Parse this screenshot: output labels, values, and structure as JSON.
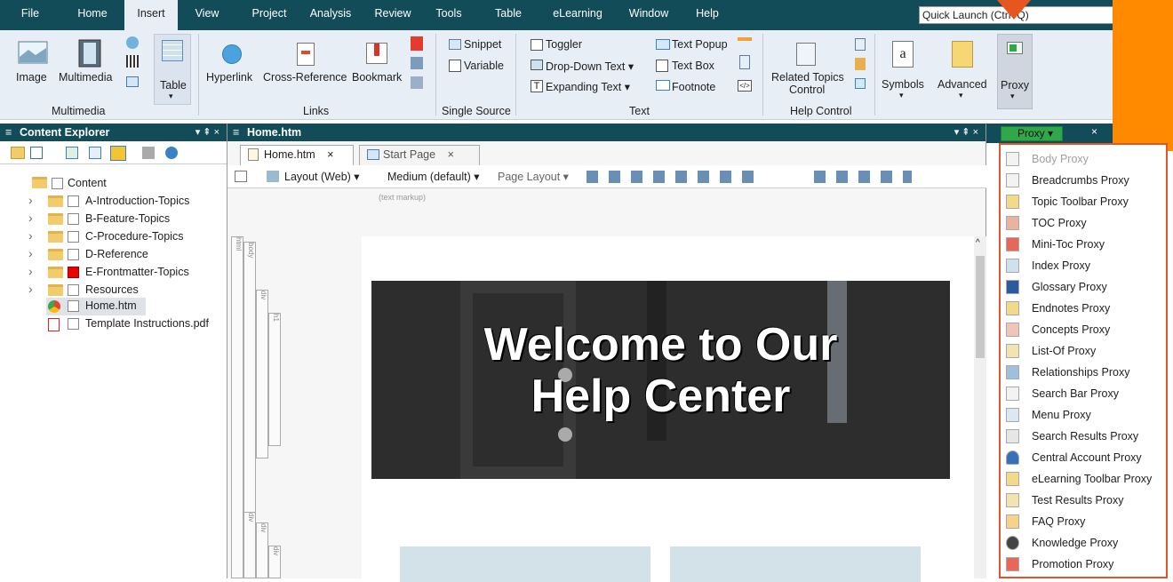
{
  "menubar": {
    "tabs": [
      "File",
      "Home",
      "Insert",
      "View",
      "Project",
      "Analysis",
      "Review",
      "Tools",
      "Table",
      "eLearning",
      "Window",
      "Help"
    ],
    "active": "Insert",
    "quick_launch": "Quick Launch (Ctrl+Q)"
  },
  "ribbon": {
    "image": "Image",
    "multimedia": "Multimedia",
    "table": "Table",
    "hyperlink": "Hyperlink",
    "crossref": "Cross-Reference",
    "bookmark": "Bookmark",
    "snippet": "Snippet",
    "variable": "Variable",
    "toggler": "Toggler",
    "dropdown_text": "Drop-Down Text",
    "expanding_text": "Expanding Text",
    "text_popup": "Text Popup",
    "text_box": "Text Box",
    "footnote": "Footnote",
    "related_topics": "Related Topics",
    "control": "Control",
    "symbols": "Symbols",
    "advanced": "Advanced",
    "proxy": "Proxy",
    "groups": {
      "multimedia": "Multimedia",
      "links": "Links",
      "single_source": "Single Source",
      "text": "Text",
      "help_control": "Help Control"
    }
  },
  "explorer": {
    "title": "Content Explorer",
    "root": "Content",
    "items": [
      {
        "label": "A-Introduction-Topics",
        "type": "folder"
      },
      {
        "label": "B-Feature-Topics",
        "type": "folder"
      },
      {
        "label": "C-Procedure-Topics",
        "type": "folder"
      },
      {
        "label": "D-Reference",
        "type": "folder"
      },
      {
        "label": "E-Frontmatter-Topics",
        "type": "folder"
      },
      {
        "label": "Resources",
        "type": "folder"
      },
      {
        "label": "Home.htm",
        "type": "file"
      },
      {
        "label": "Template Instructions.pdf",
        "type": "pdf"
      }
    ]
  },
  "editor": {
    "title": "Home.htm",
    "tabs": [
      "Home.htm",
      "Start Page"
    ],
    "toolbar": {
      "layout": "Layout (Web)",
      "medium": "Medium (default)",
      "page_layout": "Page Layout"
    },
    "text_markup": "(text markup)",
    "structure_tags": [
      "html",
      "body",
      "div",
      "h1",
      "div",
      "div",
      "div"
    ],
    "hero_line1": "Welcome to Our",
    "hero_line2": "Help Center"
  },
  "proxy": {
    "header_button": "Proxy",
    "items": [
      {
        "label": "Body Proxy",
        "disabled": true
      },
      {
        "label": "Breadcrumbs Proxy"
      },
      {
        "label": "Topic Toolbar Proxy"
      },
      {
        "label": "TOC Proxy"
      },
      {
        "label": "Mini-Toc Proxy"
      },
      {
        "label": "Index Proxy"
      },
      {
        "label": "Glossary Proxy"
      },
      {
        "label": "Endnotes Proxy"
      },
      {
        "label": "Concepts Proxy"
      },
      {
        "label": "List-Of Proxy"
      },
      {
        "label": "Relationships Proxy"
      },
      {
        "label": "Search Bar Proxy"
      },
      {
        "label": "Menu Proxy"
      },
      {
        "label": "Search Results Proxy"
      },
      {
        "label": "Central Account Proxy"
      },
      {
        "label": "eLearning Toolbar Proxy"
      },
      {
        "label": "Test Results Proxy"
      },
      {
        "label": "FAQ Proxy"
      },
      {
        "label": "Knowledge Proxy"
      },
      {
        "label": "Promotion Proxy"
      }
    ]
  },
  "colors": {
    "titlebar": "#124c59",
    "ribbon": "#e8eef6",
    "accent": "#e0552b",
    "orange": "#ff8a00"
  }
}
